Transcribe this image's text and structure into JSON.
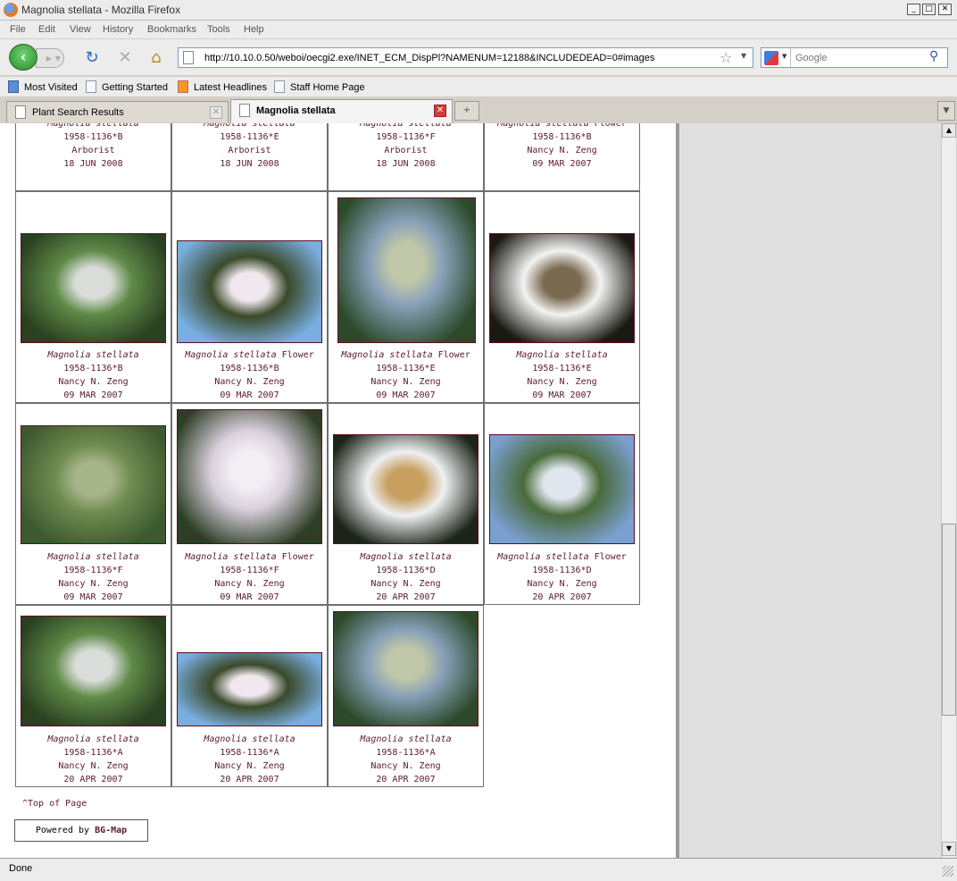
{
  "window": {
    "title": "Magnolia stellata - Mozilla Firefox"
  },
  "menu": [
    "File",
    "Edit",
    "View",
    "History",
    "Bookmarks",
    "Tools",
    "Help"
  ],
  "nav": {
    "url": "http://10.10.0.50/weboi/oecgi2.exe/INET_ECM_DispPl?NAMENUM=12188&INCLUDEDEAD=0#images",
    "search_placeholder": "Google"
  },
  "bookmarks": [
    "Most Visited",
    "Getting Started",
    "Latest Headlines",
    "Staff Home Page"
  ],
  "tabs": [
    {
      "label": "Plant Search Results"
    },
    {
      "label": "Magnolia stellata"
    }
  ],
  "rows": [
    [
      {
        "species": "Magnolia stellata",
        "part": "",
        "acc": "1958-1136*B",
        "who": "Arborist",
        "date": "18 JUN 2008"
      },
      {
        "species": "Magnolia stellata",
        "part": "",
        "acc": "1958-1136*E",
        "who": "Arborist",
        "date": "18 JUN 2008"
      },
      {
        "species": "Magnolia stellata",
        "part": "",
        "acc": "1958-1136*F",
        "who": "Arborist",
        "date": "18 JUN 2008"
      },
      {
        "species": "Magnolia stellata",
        "part": "Flower",
        "acc": "1958-1136*B",
        "who": "Nancy N. Zeng",
        "date": "09 MAR 2007"
      }
    ],
    [
      {
        "species": "Magnolia stellata",
        "part": "",
        "acc": "1958-1136*B",
        "who": "Nancy N. Zeng",
        "date": "09 MAR 2007"
      },
      {
        "species": "Magnolia stellata",
        "part": "Flower",
        "acc": "1958-1136*B",
        "who": "Nancy N. Zeng",
        "date": "09 MAR 2007"
      },
      {
        "species": "Magnolia stellata",
        "part": "Flower",
        "acc": "1958-1136*E",
        "who": "Nancy N. Zeng",
        "date": "09 MAR 2007"
      },
      {
        "species": "Magnolia stellata",
        "part": "",
        "acc": "1958-1136*E",
        "who": "Nancy N. Zeng",
        "date": "09 MAR 2007"
      }
    ],
    [
      {
        "species": "Magnolia stellata",
        "part": "",
        "acc": "1958-1136*F",
        "who": "Nancy N. Zeng",
        "date": "09 MAR 2007"
      },
      {
        "species": "Magnolia stellata",
        "part": "Flower",
        "acc": "1958-1136*F",
        "who": "Nancy N. Zeng",
        "date": "09 MAR 2007"
      },
      {
        "species": "Magnolia stellata",
        "part": "",
        "acc": "1958-1136*D",
        "who": "Nancy N. Zeng",
        "date": "20 APR 2007"
      },
      {
        "species": "Magnolia stellata",
        "part": "Flower",
        "acc": "1958-1136*D",
        "who": "Nancy N. Zeng",
        "date": "20 APR 2007"
      }
    ],
    [
      {
        "species": "Magnolia stellata",
        "part": "",
        "acc": "1958-1136*A",
        "who": "Nancy N. Zeng",
        "date": "20 APR 2007"
      },
      {
        "species": "Magnolia stellata",
        "part": "",
        "acc": "1958-1136*A",
        "who": "Nancy N. Zeng",
        "date": "20 APR 2007"
      },
      {
        "species": "Magnolia stellata",
        "part": "",
        "acc": "1958-1136*A",
        "who": "Nancy N. Zeng",
        "date": "20 APR 2007"
      }
    ]
  ],
  "footer": {
    "top_link": "^Top of Page",
    "powered_prefix": "Powered by",
    "powered_brand": "BG-Map"
  },
  "status": "Done"
}
